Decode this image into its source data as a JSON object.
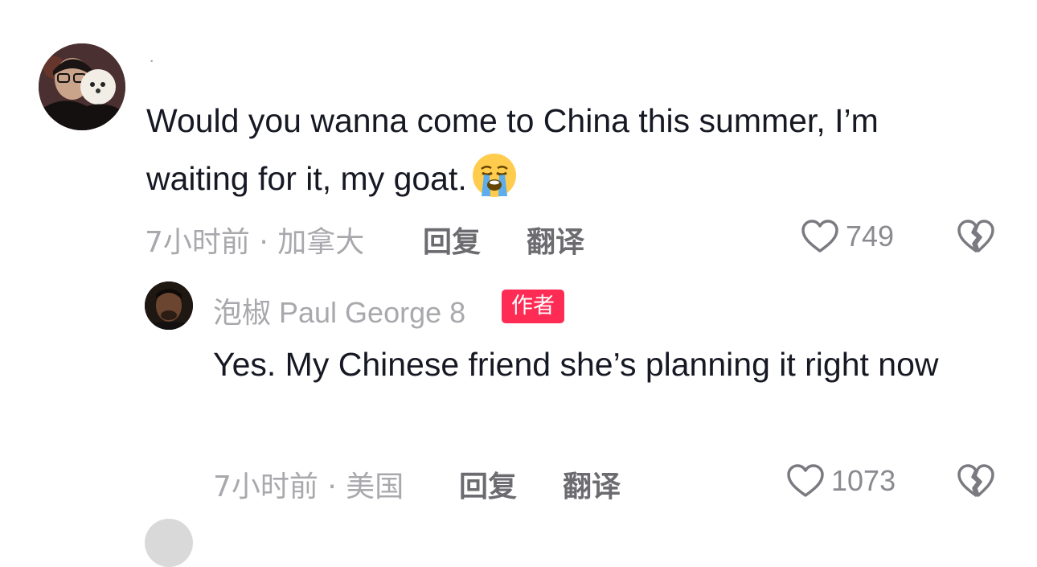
{
  "comment": {
    "username": "·",
    "text": "Would you wanna come to China this summer, I’m waiting for it, my goat.",
    "emoji": "loudly-crying-face",
    "meta": "7小时前 · 加拿大",
    "reply_label": "回复",
    "translate_label": "翻译",
    "like_count": "749"
  },
  "reply": {
    "username": "泡椒 Paul George 8",
    "badge": "作者",
    "text": "Yes. My Chinese friend she’s planning it right now",
    "meta": "7小时前 · 美国",
    "reply_label": "回复",
    "translate_label": "翻译",
    "like_count": "1073"
  },
  "colors": {
    "badge": "#fe2c55",
    "muted": "#a8a8ad",
    "text": "#161823"
  }
}
